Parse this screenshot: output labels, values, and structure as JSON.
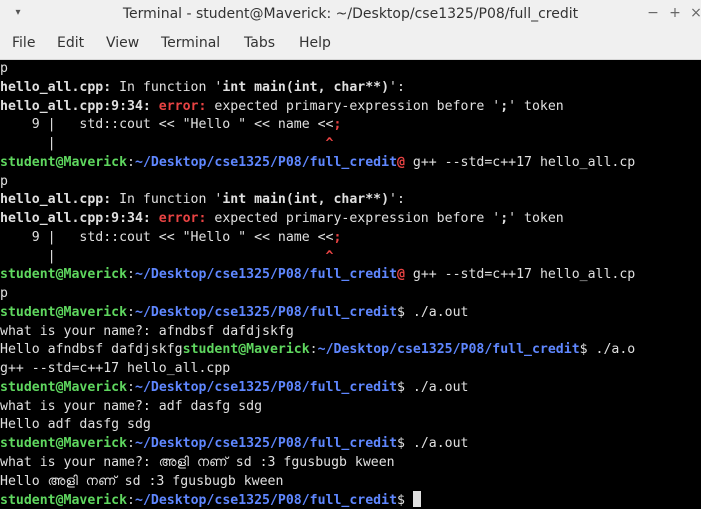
{
  "window": {
    "title": "Terminal - student@Maverick: ~/Desktop/cse1325/P08/full_credit",
    "menu_glyph": "▾",
    "minimize_glyph": "−",
    "maximize_glyph": "+",
    "close_glyph": "×"
  },
  "menubar": {
    "items": [
      "File",
      "Edit",
      "View",
      "Terminal",
      "Tabs",
      "Help"
    ]
  },
  "prompt": {
    "user": "student@Maverick",
    "colon": ":",
    "path": "~/Desktop/cse1325/P08/full_credit"
  },
  "terminal_lines": [
    [
      {
        "t": "p"
      }
    ],
    [
      {
        "t": "hello_all.cpp:",
        "s": "b"
      },
      {
        "t": " In function '"
      },
      {
        "t": "int main(int, char**)",
        "s": "b"
      },
      {
        "t": "':"
      }
    ],
    [
      {
        "t": "hello_all.cpp:9:34: ",
        "s": "b"
      },
      {
        "t": "error:",
        "s": "red"
      },
      {
        "t": " expected primary-expression before '"
      },
      {
        "t": ";",
        "s": "b"
      },
      {
        "t": "' token"
      }
    ],
    [
      {
        "t": "    9 |   std::cout << \"Hello \" << name <<"
      },
      {
        "t": ";",
        "s": "red"
      }
    ],
    [
      {
        "t": "      |                                  "
      },
      {
        "t": "^",
        "s": "red"
      }
    ],
    [
      {
        "t": "student@Maverick",
        "s": "g"
      },
      {
        "t": ":",
        "s": "c"
      },
      {
        "t": "~/Desktop/cse1325/P08/full_credit",
        "s": "u"
      },
      {
        "t": "@",
        "s": "red"
      },
      {
        "t": " g++ --std=c++17 hello_all.cp"
      }
    ],
    [
      {
        "t": "p"
      }
    ],
    [
      {
        "t": "hello_all.cpp:",
        "s": "b"
      },
      {
        "t": " In function '"
      },
      {
        "t": "int main(int, char**)",
        "s": "b"
      },
      {
        "t": "':"
      }
    ],
    [
      {
        "t": "hello_all.cpp:9:34: ",
        "s": "b"
      },
      {
        "t": "error:",
        "s": "red"
      },
      {
        "t": " expected primary-expression before '"
      },
      {
        "t": ";",
        "s": "b"
      },
      {
        "t": "' token"
      }
    ],
    [
      {
        "t": "    9 |   std::cout << \"Hello \" << name <<"
      },
      {
        "t": ";",
        "s": "red"
      }
    ],
    [
      {
        "t": "      |                                  "
      },
      {
        "t": "^",
        "s": "red"
      }
    ],
    [
      {
        "t": "student@Maverick",
        "s": "g"
      },
      {
        "t": ":",
        "s": "c"
      },
      {
        "t": "~/Desktop/cse1325/P08/full_credit",
        "s": "u"
      },
      {
        "t": "@",
        "s": "red"
      },
      {
        "t": " g++ --std=c++17 hello_all.cp"
      }
    ],
    [
      {
        "t": "p"
      }
    ],
    [
      {
        "t": "student@Maverick",
        "s": "g"
      },
      {
        "t": ":",
        "s": "c"
      },
      {
        "t": "~/Desktop/cse1325/P08/full_credit",
        "s": "u"
      },
      {
        "t": "$ ./a.out"
      }
    ],
    [
      {
        "t": "what is your name?: afndbsf dafdjskfg"
      }
    ],
    [
      {
        "t": "Hello afndbsf dafdjskfg"
      },
      {
        "t": "student@Maverick",
        "s": "g"
      },
      {
        "t": ":",
        "s": "c"
      },
      {
        "t": "~/Desktop/cse1325/P08/full_credit",
        "s": "u"
      },
      {
        "t": "$ ./a.o"
      }
    ],
    [
      {
        "t": "g++ --std=c++17 hello_all.cpp"
      }
    ],
    [
      {
        "t": "student@Maverick",
        "s": "g"
      },
      {
        "t": ":",
        "s": "c"
      },
      {
        "t": "~/Desktop/cse1325/P08/full_credit",
        "s": "u"
      },
      {
        "t": "$ ./a.out"
      }
    ],
    [
      {
        "t": "what is your name?: adf dasfg sdg"
      }
    ],
    [
      {
        "t": "Hello adf dasfg sdg"
      }
    ],
    [
      {
        "t": "student@Maverick",
        "s": "g"
      },
      {
        "t": ":",
        "s": "c"
      },
      {
        "t": "~/Desktop/cse1325/P08/full_credit",
        "s": "u"
      },
      {
        "t": "$ ./a.out"
      }
    ],
    [
      {
        "t": "what is your name?: അളി നണ് sd :3 fgusbugb kween"
      }
    ],
    [
      {
        "t": "Hello അളി നണ് sd :3 fgusbugb kween"
      }
    ],
    [
      {
        "t": "student@Maverick",
        "s": "g"
      },
      {
        "t": ":",
        "s": "c"
      },
      {
        "t": "~/Desktop/cse1325/P08/full_credit",
        "s": "u"
      },
      {
        "t": "$ "
      },
      {
        "t": "",
        "s": "cursor"
      }
    ]
  ]
}
